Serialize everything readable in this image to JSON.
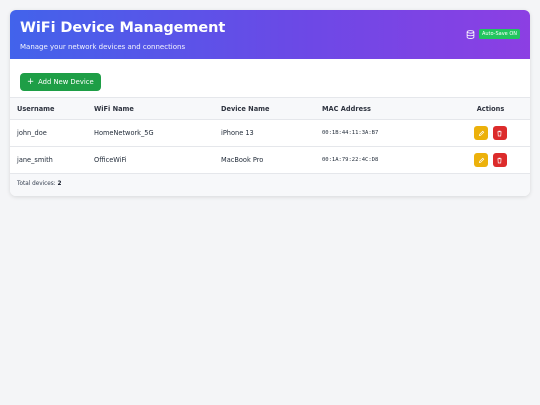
{
  "header": {
    "title": "WiFi Device Management",
    "subtitle": "Manage your network devices and connections",
    "autosave_icon": "database-icon",
    "autosave_label": "Auto-Save ON",
    "autosave_color": "#22c55e"
  },
  "toolbar": {
    "add_label": "Add New Device",
    "add_icon": "plus-icon",
    "add_color": "#1e9e46"
  },
  "table": {
    "columns": [
      "Username",
      "WiFi Name",
      "Device Name",
      "MAC Address",
      "Actions"
    ],
    "rows": [
      {
        "username": "john_doe",
        "wifi_name": "HomeNetwork_5G",
        "device_name": "iPhone 13",
        "mac_address": "00:1B:44:11:3A:B7"
      },
      {
        "username": "jane_smith",
        "wifi_name": "OfficeWiFi",
        "device_name": "MacBook Pro",
        "mac_address": "00:1A:79:22:4C:D8"
      }
    ],
    "edit_icon": "pencil-icon",
    "delete_icon": "trash-icon",
    "edit_color": "#ecb10b",
    "delete_color": "#dc2b2b"
  },
  "footer": {
    "total_label": "Total devices:",
    "total_count": "2"
  }
}
